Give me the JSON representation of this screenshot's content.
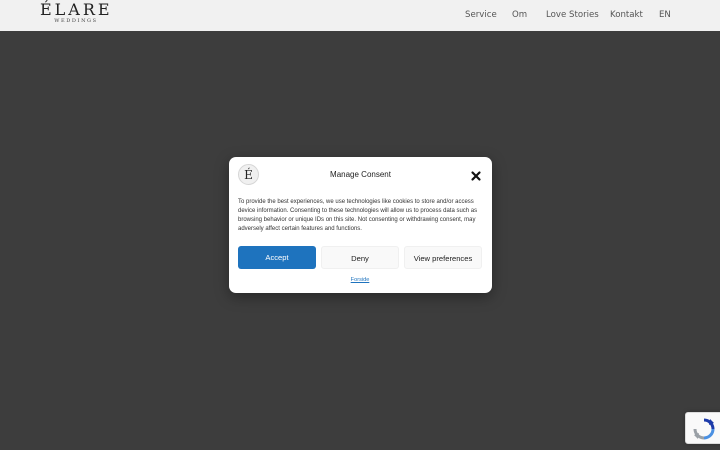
{
  "header": {
    "logo_main": "ÉLARE",
    "logo_sub": "WEDDINGS",
    "nav": [
      {
        "label": "Service"
      },
      {
        "label": "Om"
      },
      {
        "label": "Love Stories"
      },
      {
        "label": "Kontakt"
      },
      {
        "label": "EN"
      }
    ]
  },
  "consent": {
    "logo_letter": "É",
    "title": "Manage Consent",
    "close_icon": "close-icon",
    "body": "To provide the best experiences, we use technologies like cookies to store and/or access device information. Consenting to these technologies will allow us to process data such as browsing behavior or unique IDs on this site. Not consenting or withdrawing consent, may adversely affect certain features and functions.",
    "accept_label": "Accept",
    "deny_label": "Deny",
    "preferences_label": "View preferences",
    "forside_link": "Forside"
  },
  "recaptcha": {
    "icon": "recaptcha-icon"
  },
  "colors": {
    "accent": "#1e73be",
    "overlay": "#3d3d3d",
    "header_bg": "#f1f1f1"
  }
}
